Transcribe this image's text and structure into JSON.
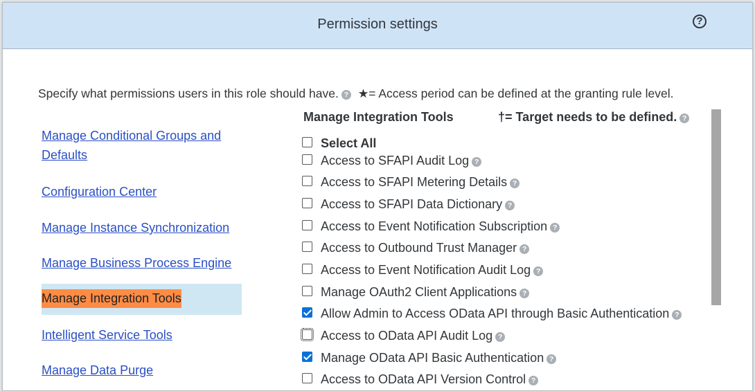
{
  "dialog": {
    "title": "Permission settings",
    "help_label": "?"
  },
  "intro": {
    "text": "Specify what permissions users in this role should have.",
    "star_note": "★= Access period can be defined at the granting rule level."
  },
  "nav": {
    "items": [
      {
        "label": "Manage Conditional Groups and Defaults"
      },
      {
        "label": "Configuration Center"
      },
      {
        "label": "Manage Instance Synchronization"
      },
      {
        "label": "Manage Business Process Engine"
      },
      {
        "label": "Manage Integration Tools",
        "selected": true
      },
      {
        "label": "Intelligent Service Tools"
      },
      {
        "label": "Manage Data Purge"
      }
    ]
  },
  "section": {
    "title": "Manage Integration Tools",
    "target_note": "†= Target needs to be defined."
  },
  "select_all": {
    "label": "Select All",
    "checked": false
  },
  "permissions": [
    {
      "label": "Access to SFAPI Audit Log",
      "checked": false
    },
    {
      "label": "Access to SFAPI Metering Details",
      "checked": false
    },
    {
      "label": "Access to SFAPI Data Dictionary",
      "checked": false
    },
    {
      "label": "Access to Event Notification Subscription",
      "checked": false
    },
    {
      "label": "Access to Outbound Trust Manager",
      "checked": false
    },
    {
      "label": "Access to Event Notification Audit Log",
      "checked": false
    },
    {
      "label": "Manage OAuth2 Client Applications",
      "checked": false
    },
    {
      "label": "Allow Admin to Access OData API through Basic Authentication",
      "checked": true
    },
    {
      "label": "Access to OData API Audit Log",
      "checked": false,
      "focused": true
    },
    {
      "label": "Manage OData API Basic Authentication",
      "checked": true
    },
    {
      "label": "Access to OData API Version Control",
      "checked": false
    }
  ],
  "colors": {
    "header_bg": "#cfe3f7",
    "link": "#2a4fc4",
    "selected_bg": "#cfe7f2",
    "selected_highlight": "#ff8c45",
    "checkbox_checked": "#0a72d4"
  },
  "icons": {
    "help": "question-circle-icon",
    "info": "question-small-icon"
  }
}
